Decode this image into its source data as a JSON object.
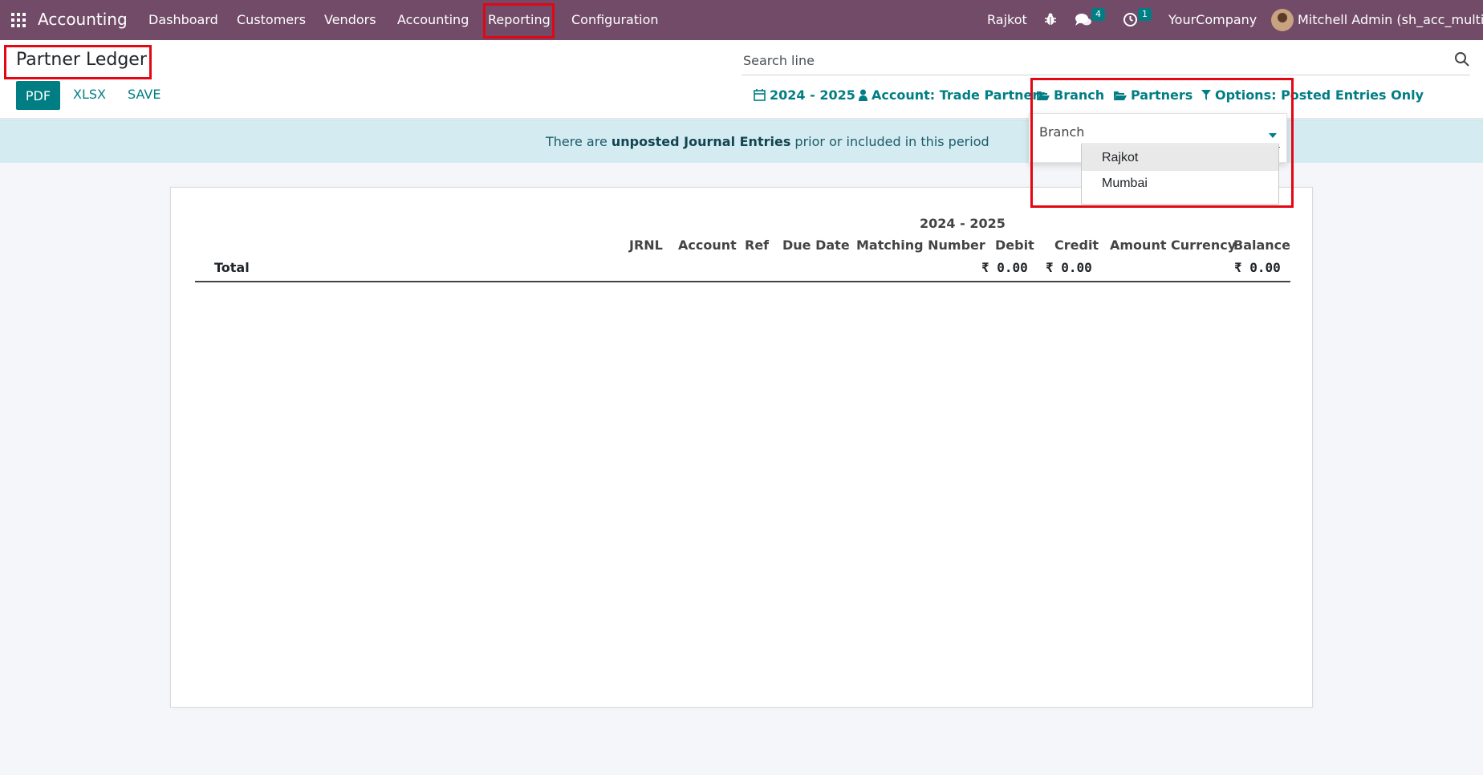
{
  "navbar": {
    "app_name": "Accounting",
    "menu": [
      "Dashboard",
      "Customers",
      "Vendors",
      "Accounting",
      "Reporting",
      "Configuration"
    ],
    "branch": "Rajkot",
    "messages_count": "4",
    "activities_count": "1",
    "company": "YourCompany",
    "user": "Mitchell Admin (sh_acc_multi)"
  },
  "control_panel": {
    "title": "Partner Ledger",
    "buttons": {
      "pdf": "PDF",
      "xlsx": "XLSX",
      "save": "SAVE"
    },
    "search_placeholder": "Search line",
    "filters": {
      "period": "2024 - 2025",
      "account": "Account: Trade Partners",
      "branch": "Branch",
      "partners": "Partners",
      "options": "Options: Posted Entries Only"
    }
  },
  "alert": {
    "prefix": "There are ",
    "bold": "unposted Journal Entries",
    "suffix": " prior or included in this period"
  },
  "branch_dropdown": {
    "label": "Branch",
    "value": "",
    "options": [
      "Rajkot",
      "Mumbai"
    ],
    "highlighted": "Rajkot"
  },
  "report": {
    "period": "2024 - 2025",
    "columns": [
      "JRNL",
      "Account",
      "Ref",
      "Due Date",
      "Matching Number",
      "Debit",
      "Credit",
      "Amount Currency",
      "Balance"
    ],
    "total_row": {
      "label": "Total",
      "debit": "₹ 0.00",
      "credit": "₹ 0.00",
      "balance": "₹ 0.00"
    }
  },
  "colors": {
    "navbar": "#714b67",
    "accent": "#017e84",
    "alert_bg": "#d4ecf1",
    "highlight": "#e30613"
  }
}
